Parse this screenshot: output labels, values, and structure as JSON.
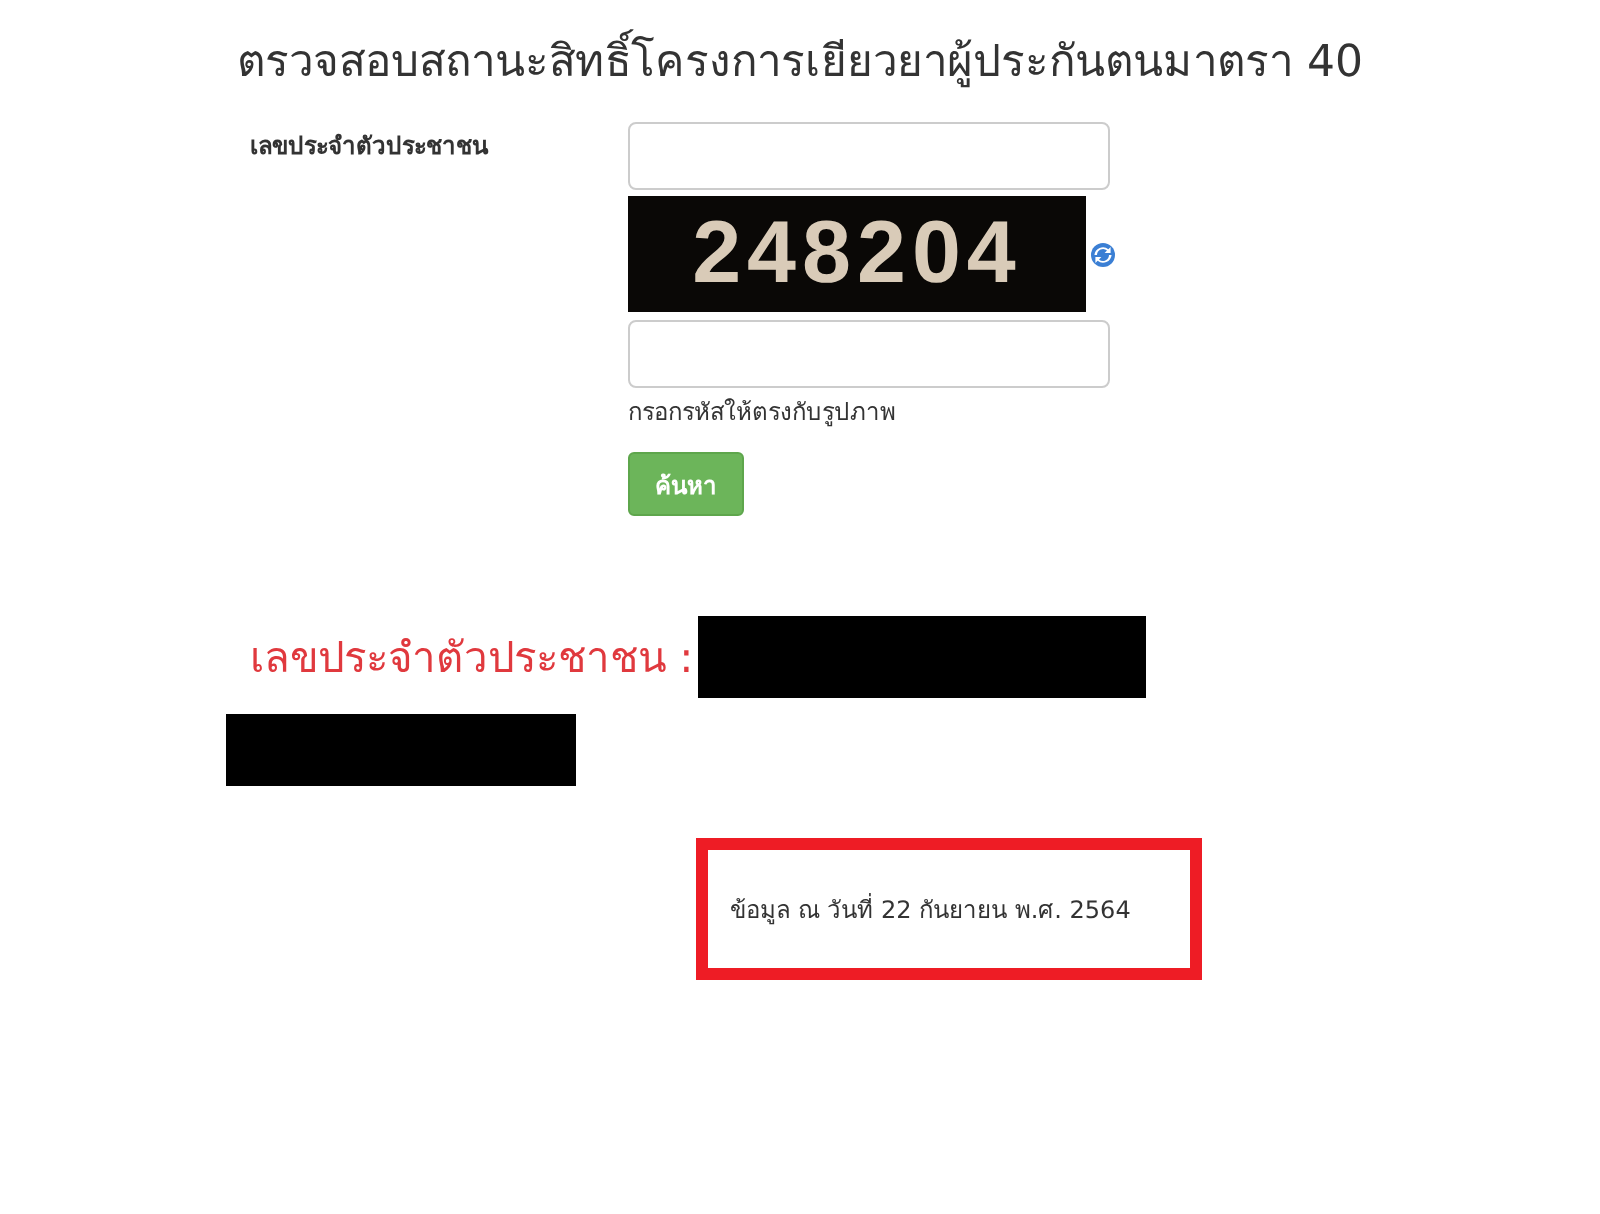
{
  "title": "ตรวจสอบสถานะสิทธิ์โครงการเยียวยาผู้ประกันตนมาตรา 40",
  "form": {
    "id_label": "เลขประจำตัวประชาชน",
    "captcha_code": "248204",
    "captcha_hint": "กรอกรหัสให้ตรงกับรูปภาพ",
    "search_button": "ค้นหา"
  },
  "result": {
    "id_label": "เลขประจำตัวประชาชน :"
  },
  "note": {
    "text": "ข้อมูล ณ วันที่ 22 กันยายน พ.ศ. 2564"
  }
}
